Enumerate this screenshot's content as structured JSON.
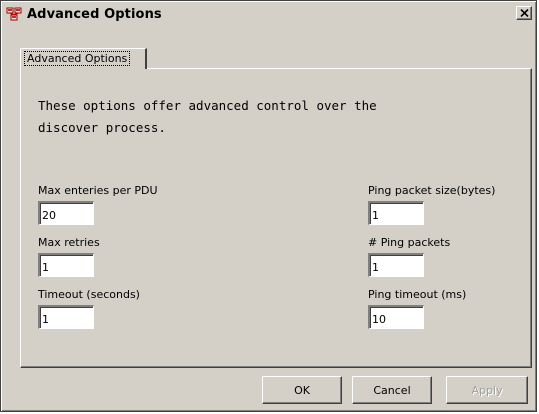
{
  "window": {
    "title": "Advanced Options",
    "app_icon": "network-discovery-icon",
    "close_icon": "close-icon"
  },
  "tabs": [
    {
      "label": "Advanced Options",
      "selected": true
    }
  ],
  "description": {
    "line1": "These options offer advanced control over the",
    "line2": "discover process."
  },
  "fields": {
    "max_entries": {
      "label": "Max enteries per PDU",
      "value": "20"
    },
    "max_retries": {
      "label": "Max retries",
      "value": "1"
    },
    "timeout": {
      "label": "Timeout (seconds)",
      "value": "1"
    },
    "ping_packet_size": {
      "label": "Ping packet size(bytes)",
      "value": "1"
    },
    "ping_packets": {
      "label": "# Ping packets",
      "value": "1"
    },
    "ping_timeout": {
      "label": "Ping timeout (ms)",
      "value": "10"
    }
  },
  "buttons": {
    "ok": "OK",
    "cancel": "Cancel",
    "apply": "Apply"
  },
  "colors": {
    "face": "#d4d0c8",
    "highlight": "#ffffff",
    "shadow": "#808080",
    "dark_shadow": "#404040",
    "disabled_text": "#a0a0a0"
  }
}
